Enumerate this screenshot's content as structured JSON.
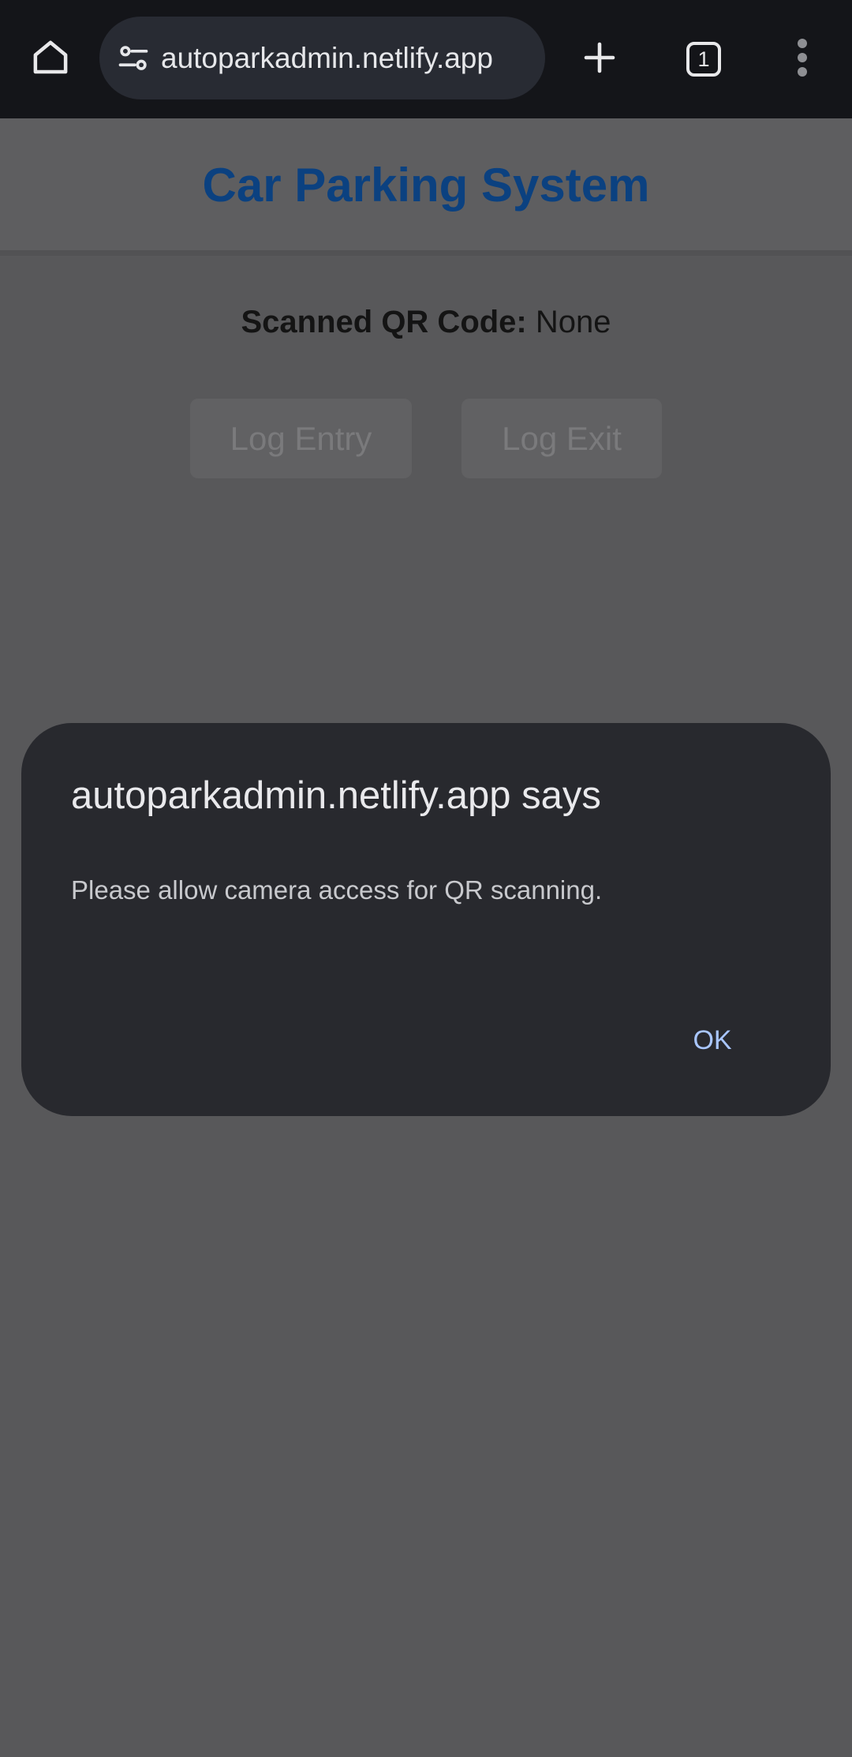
{
  "browser": {
    "url": "autoparkadmin.netlify.app",
    "tab_count": "1",
    "icons": {
      "home": "home-icon",
      "site_settings": "tune-icon",
      "new_tab": "plus-icon",
      "tabs": "tab-switcher-icon",
      "menu": "more-vert-icon"
    }
  },
  "page": {
    "title": "Car Parking System",
    "scanned_label": "Scanned QR Code:",
    "scanned_value": "None",
    "log_entry_label": "Log Entry",
    "log_exit_label": "Log Exit"
  },
  "dialog": {
    "title": "autoparkadmin.netlify.app says",
    "message": "Please allow camera access for QR scanning.",
    "ok_label": "OK"
  },
  "colors": {
    "title_blue": "#0b4180",
    "dialog_bg": "#28292e",
    "ok_text": "#a9c6ff",
    "toolbar_bg": "#141519",
    "scrim_page": "#58585a"
  }
}
